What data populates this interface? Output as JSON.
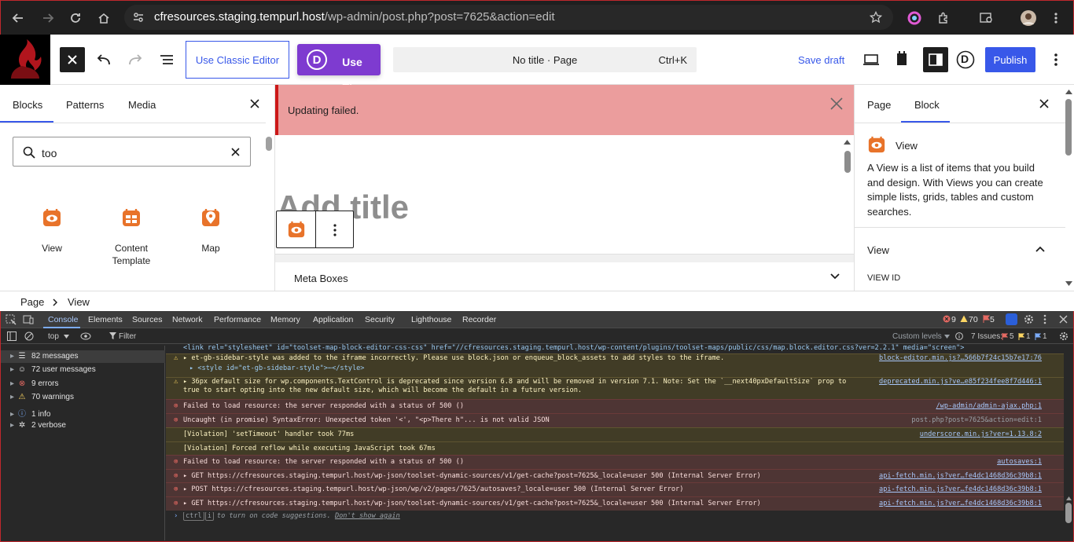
{
  "browser": {
    "url_host": "cfresources.staging.tempurl.host",
    "url_path": "/wp-admin/post.php?post=7625&action=edit"
  },
  "header": {
    "classic_editor_label": "Use Classic Editor",
    "divi_logo_letter": "D",
    "divi_label": "Use The Divi Builder",
    "command_title": "No title · Page",
    "command_shortcut": "Ctrl+K",
    "save_draft": "Save draft",
    "publish": "Publish",
    "divi_toggle_letter": "D",
    "brand_color": "#3858e9"
  },
  "inserter": {
    "tabs": [
      "Blocks",
      "Patterns",
      "Media"
    ],
    "search_value": "too",
    "blocks": [
      {
        "label": "View",
        "icon": "eye-icon"
      },
      {
        "label": "Content Template",
        "icon": "template-icon"
      },
      {
        "label": "Map",
        "icon": "map-pin-icon"
      }
    ],
    "icon_color": "#e8732a"
  },
  "canvas": {
    "notice": "Updating failed.",
    "title_placeholder": "Add title",
    "meta_boxes": "Meta Boxes"
  },
  "sidebar": {
    "tabs": [
      "Page",
      "Block"
    ],
    "block_title": "View",
    "block_description": "A View is a list of items that you build and design. With Views you can create simple lists, grids, tables and custom searches.",
    "panel_title": "View",
    "field_label": "VIEW ID"
  },
  "breadcrumb": [
    "Page",
    "View"
  ],
  "devtools": {
    "tabs": [
      "Console",
      "Elements",
      "Sources",
      "Network",
      "Performance",
      "Memory",
      "Application",
      "Security",
      "Lighthouse",
      "Recorder"
    ],
    "counts": {
      "errors": "9",
      "warnings": "70",
      "issues_badge": "5"
    },
    "context": "top",
    "filter_placeholder": "Filter",
    "levels": "Custom levels",
    "issues_label": "7 Issues:",
    "issues": {
      "errors": "5",
      "warnings": "1",
      "info": "1"
    },
    "side_items": [
      {
        "label": "82 messages",
        "icon": "list-icon"
      },
      {
        "label": "72 user messages",
        "icon": "user-icon"
      },
      {
        "label": "9 errors",
        "icon": "error-icon"
      },
      {
        "label": "70 warnings",
        "icon": "warning-icon"
      },
      {
        "label": "1 info",
        "icon": "info-icon"
      },
      {
        "label": "2 verbose",
        "icon": "bug-icon"
      }
    ],
    "log": [
      {
        "type": "plain",
        "msg": "<link rel=\"stylesheet\" id=\"toolset-map-block-editor-css-css\" href=\"//cfresources.staging.tempurl.host/wp-content/plugins/toolset-maps/public/css/map.block.editor.css?ver=2.2.1\" media=\"screen\">",
        "src": ""
      },
      {
        "type": "warn",
        "msg": "▸ et-gb-sidebar-style was added to the iframe incorrectly. Please use block.json or enqueue_block_assets to add styles to the iframe.",
        "src": "block-editor.min.js?…566b7f24c15b7e17:76"
      },
      {
        "type": "warn2",
        "msg": "▸ <style id=\"et-gb-sidebar-style\">⋯</style>",
        "src": ""
      },
      {
        "type": "warn",
        "msg": "▸ 36px default size for wp.components.TextControl is deprecated since version 6.8 and will be removed in version 7.1. Note: Set the `__next40pxDefaultSize` prop to",
        "src": "deprecated.min.js?ve…e85f234fee8f7d446:1"
      },
      {
        "type": "warn2",
        "msg": "true to start opting into the new default size, which will become the default in a future version.",
        "src": ""
      },
      {
        "type": "err",
        "msg": "Failed to load resource: the server responded with a status of 500 ()",
        "src": "/wp-admin/admin-ajax.php:1"
      },
      {
        "type": "err",
        "msg": "Uncaught (in promise) SyntaxError: Unexpected token '<', \"<p>There h\"... is not valid JSON",
        "src": "post.php?post=7625&action=edit:1"
      },
      {
        "type": "warn",
        "msg": "[Violation] 'setTimeout' handler took 77ms",
        "src": "underscore.min.js?ver=1.13.8:2"
      },
      {
        "type": "warn",
        "msg": "[Violation] Forced reflow while executing JavaScript took 67ms",
        "src": ""
      },
      {
        "type": "err",
        "msg": "Failed to load resource: the server responded with a status of 500 ()",
        "src": "autosaves:1"
      },
      {
        "type": "err",
        "msg": "▸ GET https://cfresources.staging.tempurl.host/wp-json/toolset-dynamic-sources/v1/get-cache?post=7625&_locale=user 500 (Internal Server Error)",
        "src": "api-fetch.min.js?ver…fe4dc1468d36c39b8:1"
      },
      {
        "type": "err",
        "msg": "▸ POST https://cfresources.staging.tempurl.host/wp-json/wp/v2/pages/7625/autosaves?_locale=user 500 (Internal Server Error)",
        "src": "api-fetch.min.js?ver…fe4dc1468d36c39b8:1"
      },
      {
        "type": "err",
        "msg": "▸ GET https://cfresources.staging.tempurl.host/wp-json/toolset-dynamic-sources/v1/get-cache?post=7625&_locale=user 500 (Internal Server Error)",
        "src": "api-fetch.min.js?ver…fe4dc1468d36c39b8:1"
      }
    ],
    "prompt_hint_key1": "ctrl",
    "prompt_hint_key2": "i",
    "prompt_hint": "to turn on code suggestions.",
    "prompt_dont_show": "Don't show again"
  }
}
